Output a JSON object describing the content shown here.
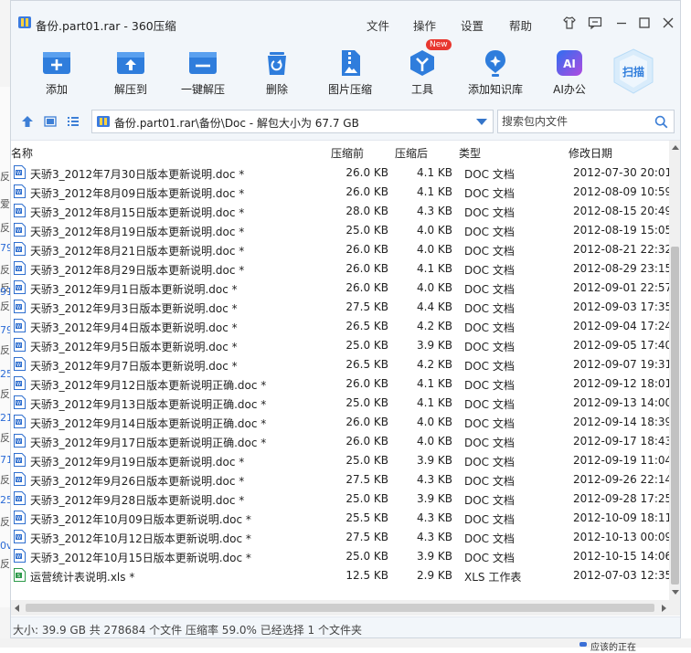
{
  "window": {
    "title": "备份.part01.rar - 360压缩",
    "menu": [
      "文件",
      "操作",
      "设置",
      "帮助"
    ]
  },
  "toolbar": {
    "tools": [
      {
        "label": "添加",
        "icon": "add-icon"
      },
      {
        "label": "解压到",
        "icon": "extract-to-icon"
      },
      {
        "label": "一键解压",
        "icon": "one-click-extract-icon"
      },
      {
        "label": "删除",
        "icon": "delete-icon"
      },
      {
        "label": "图片压缩",
        "icon": "image-compress-icon"
      },
      {
        "label": "工具",
        "icon": "tools-icon",
        "badge": "New"
      },
      {
        "label": "添加知识库",
        "icon": "knowledge-base-icon"
      },
      {
        "label": "AI办公",
        "icon": "ai-office-icon",
        "icon_text": "AI"
      }
    ],
    "scan_label": "扫描"
  },
  "address": {
    "path": "备份.part01.rar\\备份\\Doc - 解包大小为 67.7 GB",
    "search_placeholder": "搜索包内文件"
  },
  "columns": {
    "name": "名称",
    "packed": "压缩前",
    "compressed": "压缩后",
    "type": "类型",
    "modified": "修改日期"
  },
  "files": [
    {
      "name": "天骄3_2012年7月30日版本更新说明.doc *",
      "packed": "26.0 KB",
      "compressed": "4.1 KB",
      "type": "DOC 文档",
      "modified": "2012-07-30 20:01",
      "icon": "doc"
    },
    {
      "name": "天骄3_2012年8月09日版本更新说明.doc *",
      "packed": "26.0 KB",
      "compressed": "4.1 KB",
      "type": "DOC 文档",
      "modified": "2012-08-09 10:59",
      "icon": "doc"
    },
    {
      "name": "天骄3_2012年8月15日版本更新说明.doc *",
      "packed": "28.0 KB",
      "compressed": "4.3 KB",
      "type": "DOC 文档",
      "modified": "2012-08-15 20:49",
      "icon": "doc"
    },
    {
      "name": "天骄3_2012年8月19日版本更新说明.doc *",
      "packed": "25.0 KB",
      "compressed": "4.0 KB",
      "type": "DOC 文档",
      "modified": "2012-08-19 15:05",
      "icon": "doc"
    },
    {
      "name": "天骄3_2012年8月21日版本更新说明.doc *",
      "packed": "26.0 KB",
      "compressed": "4.0 KB",
      "type": "DOC 文档",
      "modified": "2012-08-21 22:32",
      "icon": "doc"
    },
    {
      "name": "天骄3_2012年8月29日版本更新说明.doc *",
      "packed": "26.0 KB",
      "compressed": "4.1 KB",
      "type": "DOC 文档",
      "modified": "2012-08-29 23:15",
      "icon": "doc"
    },
    {
      "name": "天骄3_2012年9月1日版本更新说明.doc *",
      "packed": "26.0 KB",
      "compressed": "4.0 KB",
      "type": "DOC 文档",
      "modified": "2012-09-01 22:57",
      "icon": "doc"
    },
    {
      "name": "天骄3_2012年9月3日版本更新说明.doc *",
      "packed": "27.5 KB",
      "compressed": "4.4 KB",
      "type": "DOC 文档",
      "modified": "2012-09-03 17:35",
      "icon": "doc"
    },
    {
      "name": "天骄3_2012年9月4日版本更新说明.doc *",
      "packed": "26.5 KB",
      "compressed": "4.2 KB",
      "type": "DOC 文档",
      "modified": "2012-09-04 17:24",
      "icon": "doc"
    },
    {
      "name": "天骄3_2012年9月5日版本更新说明.doc *",
      "packed": "25.0 KB",
      "compressed": "3.9 KB",
      "type": "DOC 文档",
      "modified": "2012-09-05 17:40",
      "icon": "doc"
    },
    {
      "name": "天骄3_2012年9月7日版本更新说明.doc *",
      "packed": "26.5 KB",
      "compressed": "4.2 KB",
      "type": "DOC 文档",
      "modified": "2012-09-07 19:31",
      "icon": "doc"
    },
    {
      "name": "天骄3_2012年9月12日版本更新说明正确.doc *",
      "packed": "26.0 KB",
      "compressed": "4.1 KB",
      "type": "DOC 文档",
      "modified": "2012-09-12 18:01",
      "icon": "doc"
    },
    {
      "name": "天骄3_2012年9月13日版本更新说明正确.doc *",
      "packed": "25.0 KB",
      "compressed": "4.1 KB",
      "type": "DOC 文档",
      "modified": "2012-09-13 14:00",
      "icon": "doc"
    },
    {
      "name": "天骄3_2012年9月14日版本更新说明正确.doc *",
      "packed": "26.0 KB",
      "compressed": "4.0 KB",
      "type": "DOC 文档",
      "modified": "2012-09-14 18:39",
      "icon": "doc"
    },
    {
      "name": "天骄3_2012年9月17日版本更新说明正确.doc *",
      "packed": "26.0 KB",
      "compressed": "4.0 KB",
      "type": "DOC 文档",
      "modified": "2012-09-17 18:43",
      "icon": "doc"
    },
    {
      "name": "天骄3_2012年9月19日版本更新说明.doc *",
      "packed": "25.0 KB",
      "compressed": "3.9 KB",
      "type": "DOC 文档",
      "modified": "2012-09-19 11:04",
      "icon": "doc"
    },
    {
      "name": "天骄3_2012年9月26日版本更新说明.doc *",
      "packed": "27.5 KB",
      "compressed": "4.3 KB",
      "type": "DOC 文档",
      "modified": "2012-09-26 22:14",
      "icon": "doc"
    },
    {
      "name": "天骄3_2012年9月28日版本更新说明.doc *",
      "packed": "25.0 KB",
      "compressed": "3.9 KB",
      "type": "DOC 文档",
      "modified": "2012-09-28 17:25",
      "icon": "doc"
    },
    {
      "name": "天骄3_2012年10月09日版本更新说明.doc *",
      "packed": "25.5 KB",
      "compressed": "4.3 KB",
      "type": "DOC 文档",
      "modified": "2012-10-09 18:11",
      "icon": "doc"
    },
    {
      "name": "天骄3_2012年10月12日版本更新说明.doc *",
      "packed": "27.5 KB",
      "compressed": "4.3 KB",
      "type": "DOC 文档",
      "modified": "2012-10-13 00:09",
      "icon": "doc"
    },
    {
      "name": "天骄3_2012年10月15日版本更新说明.doc *",
      "packed": "25.0 KB",
      "compressed": "3.9 KB",
      "type": "DOC 文档",
      "modified": "2012-10-15 14:06",
      "icon": "doc"
    },
    {
      "name": "运营统计表说明.xls *",
      "packed": "12.5 KB",
      "compressed": "2.9 KB",
      "type": "XLS 工作表",
      "modified": "2012-07-03 12:35",
      "icon": "xls"
    }
  ],
  "status": {
    "text": "大小: 39.9 GB 共 278684 个文件 压缩率 59.0% 已经选择 1 个文件夹"
  },
  "background": {
    "left_glyphs": [
      "反",
      "爱",
      "反",
      "79",
      "反",
      "反",
      "91",
      "反",
      "79",
      "反",
      "25",
      "反",
      "21",
      "反",
      "71",
      "反",
      "25",
      "反",
      "0v",
      "反"
    ],
    "bottom_note": "应该的正在"
  },
  "colors": {
    "accent": "#2f7ddc",
    "toolbar_bg": "#f2f6fa",
    "badge": "#e8372f",
    "ai_gradient_start": "#2e6ff0",
    "ai_gradient_end": "#b04ae0"
  }
}
